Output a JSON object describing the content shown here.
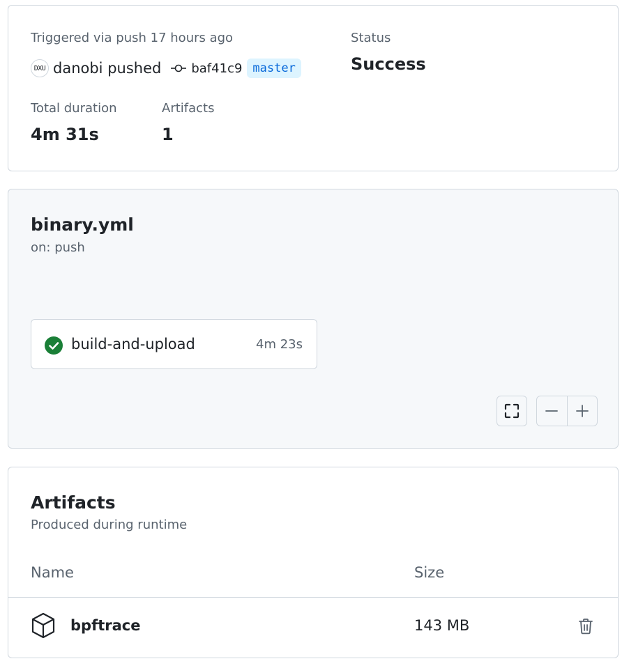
{
  "summary": {
    "trigger_text": "Triggered via push 17 hours ago",
    "avatar_initials": "DXU",
    "pusher_text": "danobi pushed",
    "commit_sha": "baf41c9",
    "branch": "master",
    "status_label": "Status",
    "status_value": "Success",
    "duration_label": "Total duration",
    "duration_value": "4m 31s",
    "artifacts_label": "Artifacts",
    "artifacts_value": "1"
  },
  "workflow": {
    "file_name": "binary.yml",
    "trigger": "on: push",
    "job": {
      "name": "build-and-upload",
      "duration": "4m 23s",
      "status_icon": "check-circle-fill-icon",
      "status_color": "#1a7f37"
    },
    "controls": {
      "fullscreen_icon": "fullscreen-icon",
      "zoom_out_icon": "minus-icon",
      "zoom_in_icon": "plus-icon"
    }
  },
  "artifacts": {
    "title": "Artifacts",
    "subtitle": "Produced during runtime",
    "columns": [
      "Name",
      "Size"
    ],
    "rows": [
      {
        "icon": "package-icon",
        "name": "bpftrace",
        "size": "143 MB",
        "action_icon": "trash-icon"
      }
    ]
  },
  "colors": {
    "accent": "#0969da",
    "branch_bg": "#ddf4ff",
    "success": "#1a7f37",
    "border": "#d0d7de",
    "muted_text": "#59636e",
    "graph_bg": "#f6f8fa"
  }
}
